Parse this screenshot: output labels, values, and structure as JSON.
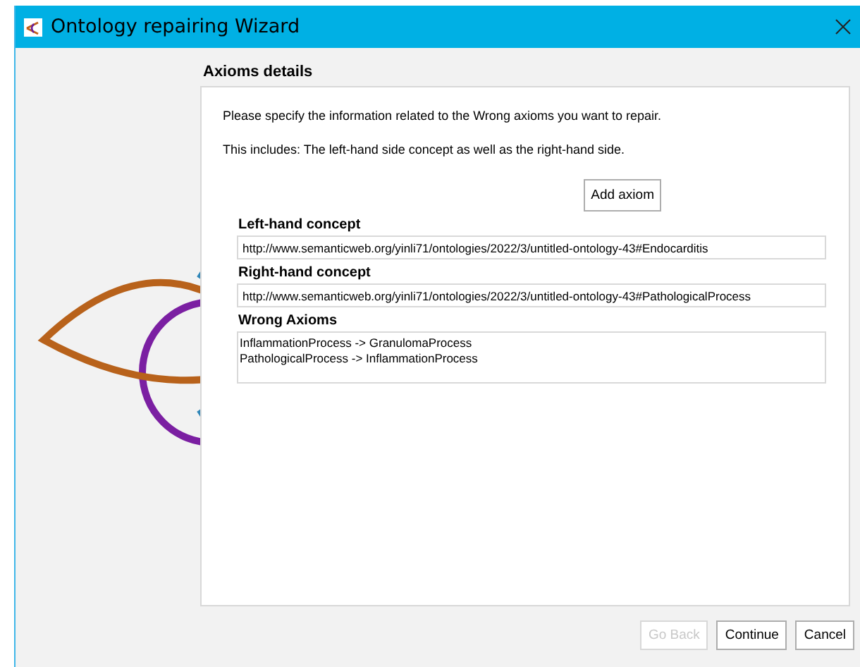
{
  "window": {
    "title": "Ontology repairing Wizard"
  },
  "page": {
    "heading": "Axioms details",
    "intro": "Please specify the information related to the Wrong axioms you want to repair.",
    "note": "This includes: The left-hand side concept as well as the right-hand side.",
    "add_button": "Add axiom"
  },
  "fields": [
    {
      "label": "Left-hand concept",
      "value": "http://www.semanticweb.org/yinli71/ontologies/2022/3/untitled-ontology-43#Endocarditis"
    },
    {
      "label": "Right-hand concept",
      "value": "http://www.semanticweb.org/yinli71/ontologies/2022/3/untitled-ontology-43#PathologicalProcess"
    }
  ],
  "wrong_axioms": {
    "label": "Wrong Axioms",
    "lines": [
      "InflammationProcess -> GranulomaProcess",
      "PathologicalProcess -> InflammationProcess"
    ]
  },
  "buttons": [
    {
      "label": "Go Back",
      "disabled": true
    },
    {
      "label": "Continue",
      "disabled": false
    },
    {
      "label": "Cancel",
      "disabled": false
    }
  ]
}
